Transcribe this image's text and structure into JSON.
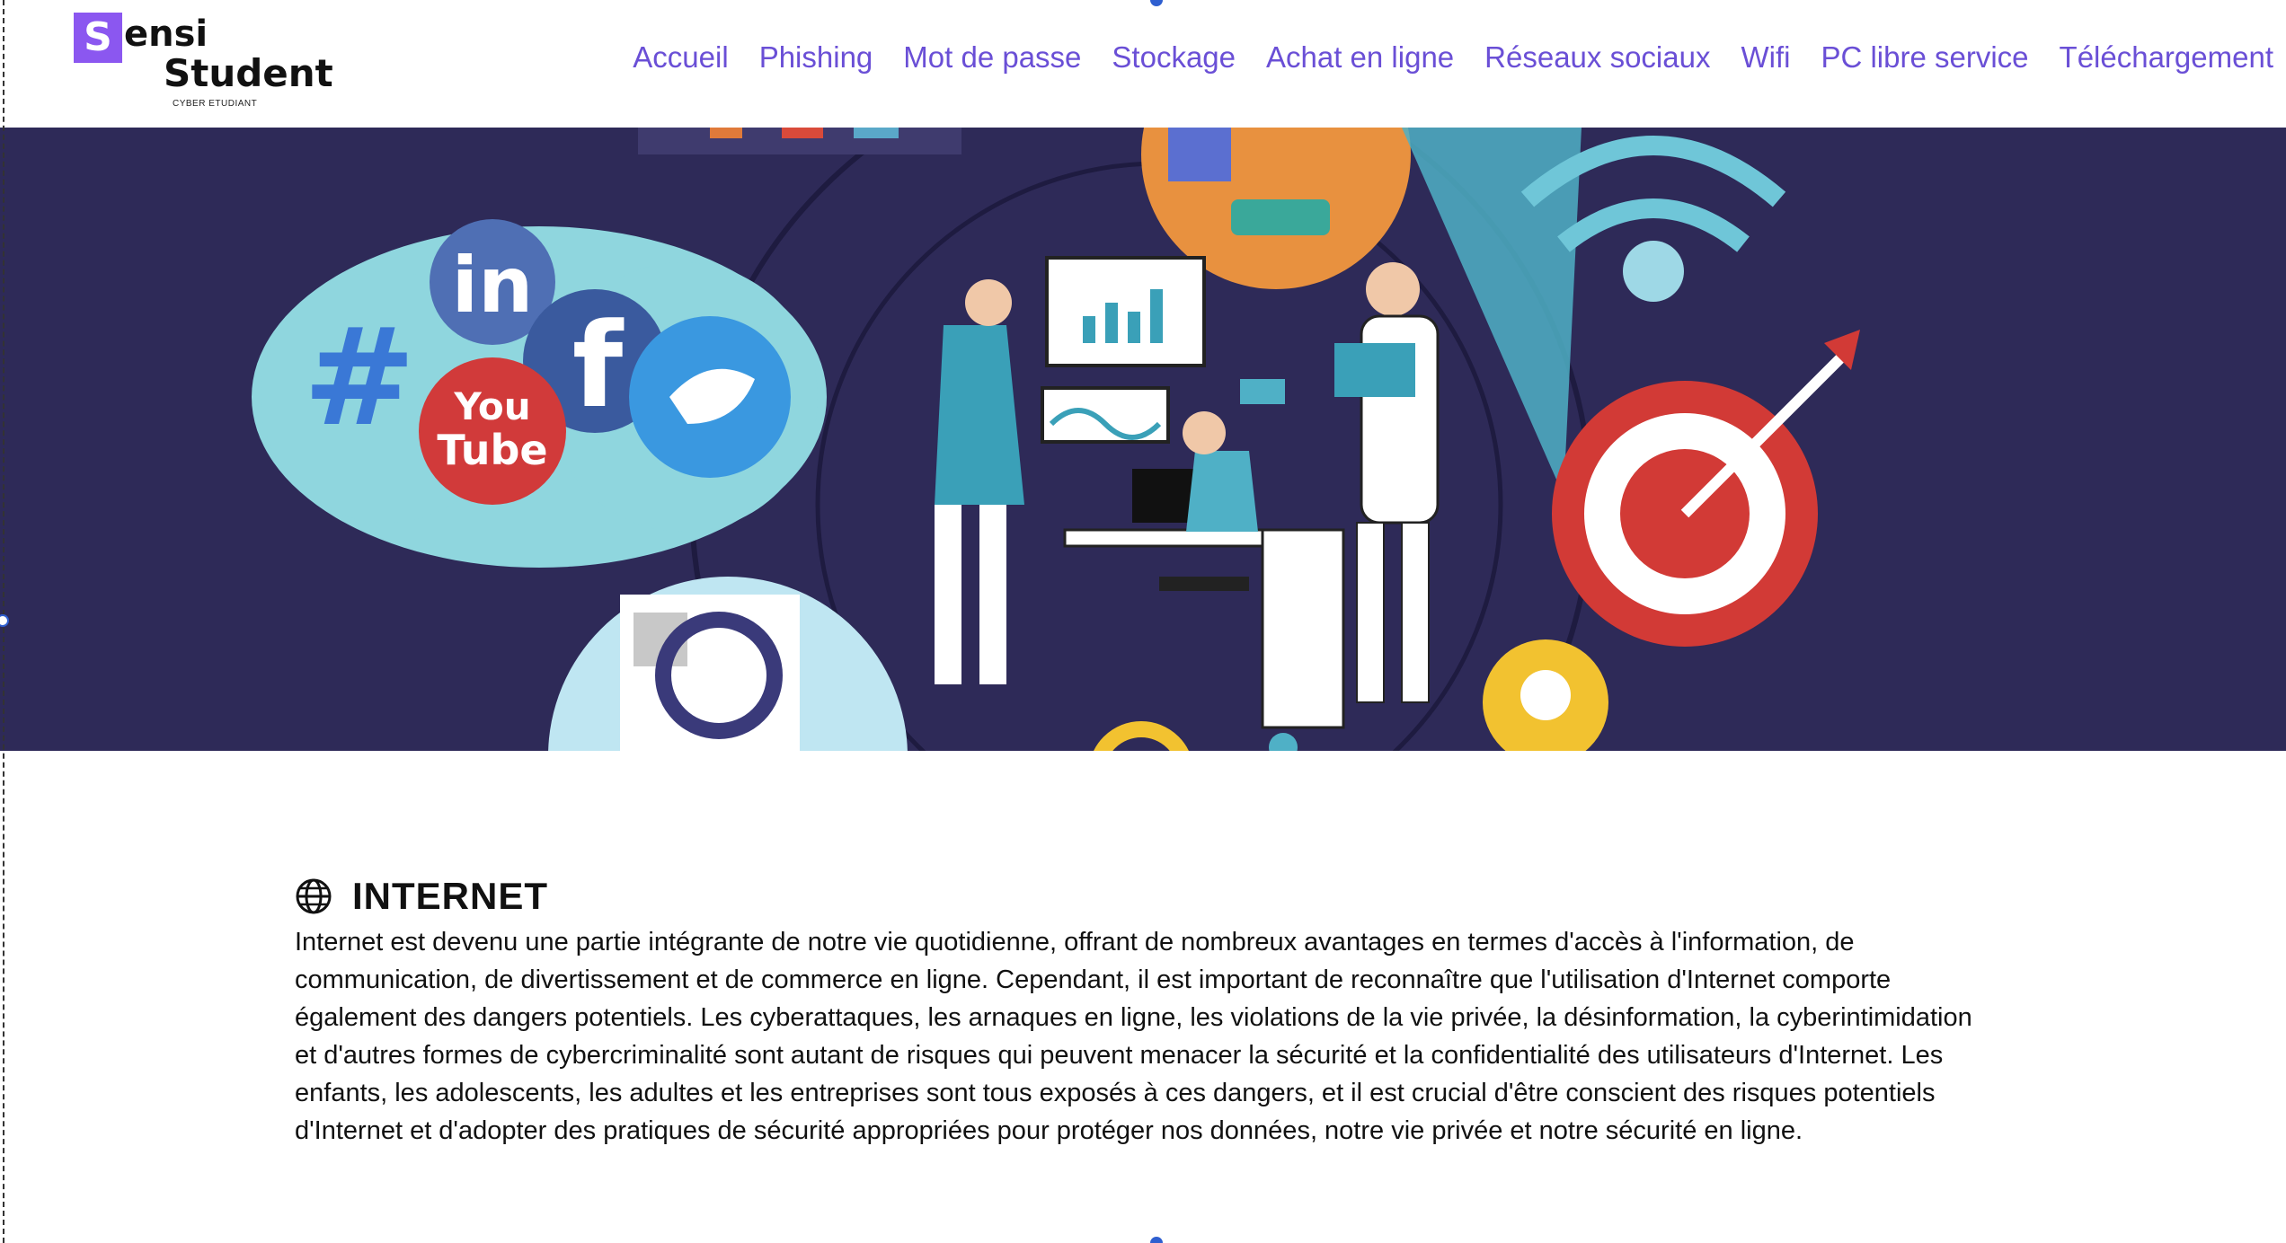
{
  "brand": {
    "logo_letter": "S",
    "logo_word1": "ensi",
    "logo_word2": "Student",
    "tagline": "CYBER ETUDIANT",
    "accent_color": "#8b57f0"
  },
  "nav": {
    "items": [
      {
        "label": "Accueil"
      },
      {
        "label": "Phishing"
      },
      {
        "label": "Mot de passe"
      },
      {
        "label": "Stockage"
      },
      {
        "label": "Achat en ligne"
      },
      {
        "label": "Réseaux sociaux"
      },
      {
        "label": "Wifi"
      },
      {
        "label": "PC libre service"
      },
      {
        "label": "Téléchargement"
      }
    ],
    "link_color": "#6a4fd6"
  },
  "hero": {
    "background_color": "#2e2a58",
    "logos": {
      "linkedin": "in",
      "facebook": "f",
      "youtube_line1": "You",
      "youtube_line2": "Tube",
      "hashtag": "#"
    }
  },
  "section": {
    "icon": "globe-icon",
    "title": "INTERNET",
    "body": "Internet est devenu une partie intégrante de notre vie quotidienne, offrant de nombreux avantages en termes d'accès à l'information, de communication, de divertissement et de commerce en ligne. Cependant, il est important de reconnaître que l'utilisation d'Internet comporte également des dangers potentiels. Les cyberattaques, les arnaques en ligne, les violations de la vie privée, la désinformation, la cyberintimidation et d'autres formes de cybercriminalité sont autant de risques qui peuvent menacer la sécurité et la confidentialité des utilisateurs d'Internet. Les enfants, les adolescents, les adultes et les entreprises sont tous exposés à ces dangers, et il est crucial d'être conscient des risques potentiels d'Internet et d'adopter des pratiques de sécurité appropriées pour protéger nos données, notre vie privée et notre sécurité en ligne."
  }
}
